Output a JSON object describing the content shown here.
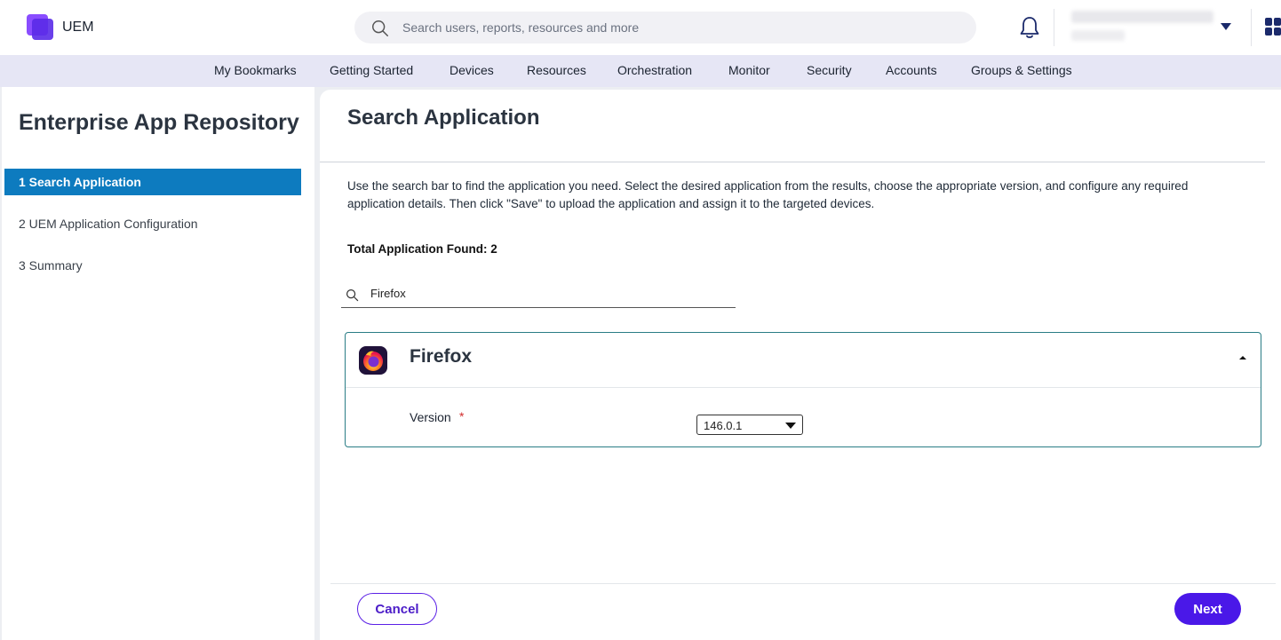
{
  "header": {
    "app_name": "UEM",
    "search_placeholder": "Search users, reports, resources and more",
    "icons": [
      "logo-icon",
      "search-icon",
      "bell-icon",
      "chevron-down-icon",
      "apps-grid-icon"
    ]
  },
  "nav": {
    "items": [
      "My Bookmarks",
      "Getting Started",
      "Devices",
      "Resources",
      "Orchestration",
      "Monitor",
      "Security",
      "Accounts",
      "Groups & Settings"
    ]
  },
  "sidebar": {
    "title": "Enterprise App Repository",
    "steps": [
      {
        "label": "1 Search Application",
        "active": true
      },
      {
        "label": "2  UEM Application Configuration",
        "active": false
      },
      {
        "label": "3  Summary",
        "active": false
      }
    ]
  },
  "main": {
    "heading": "Search Application",
    "description": "Use the search bar to find the application you need. Select the desired application from the results, choose the appropriate version, and configure any required application details. Then click \"Save\" to upload the application and assign it to the targeted devices.",
    "total_found": "Total Application Found: 2",
    "search_value": "Firefox",
    "result": {
      "app_name": "Firefox",
      "version_label": "Version",
      "required_mark": "*",
      "version_value": "146.0.1"
    }
  },
  "footer": {
    "cancel_label": "Cancel",
    "next_label": "Next"
  },
  "colors": {
    "accent": "#4a18e8",
    "active_step": "#0d7bbf",
    "nav_bg": "#e6e6f5",
    "card_border": "#2a7d86"
  }
}
